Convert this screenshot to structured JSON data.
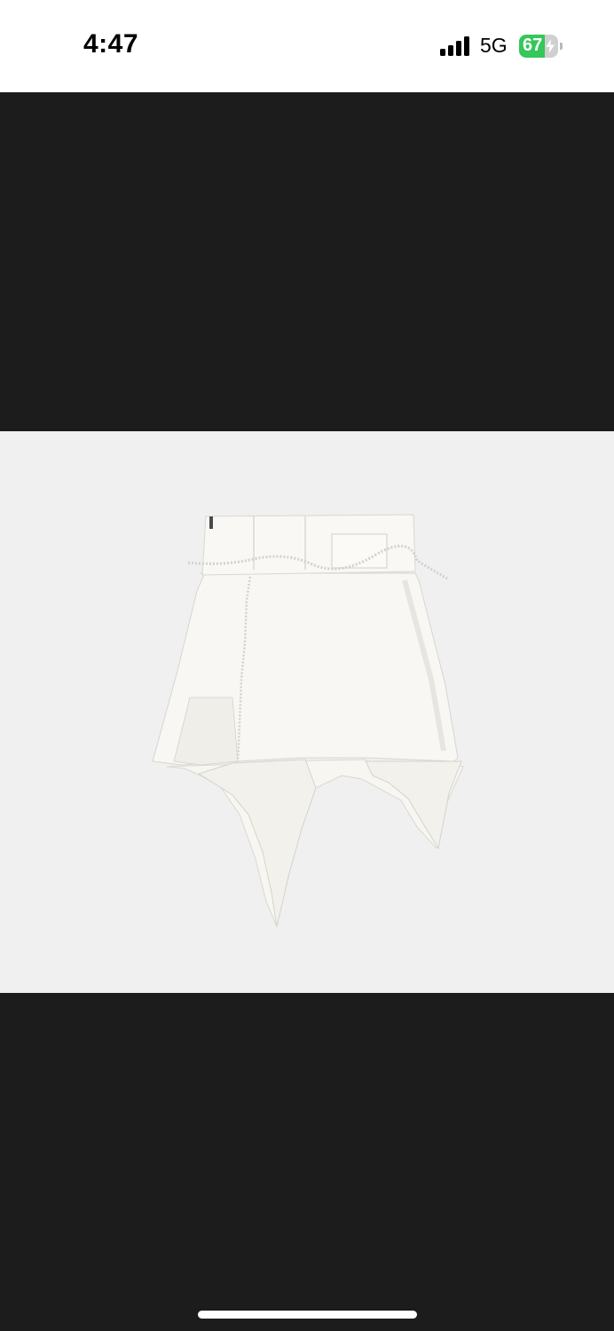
{
  "status_bar": {
    "time": "4:47",
    "network": "5G",
    "battery_percent": "67",
    "battery_level": 0.67,
    "battery_color": "#34c759",
    "charging": true,
    "signal_bars": 4
  },
  "viewer": {
    "background_color": "#1c1c1c",
    "image_background_color": "#f0f0f0"
  },
  "icons": {
    "signal": "cellular-signal-icon",
    "battery": "battery-icon",
    "bolt": "charging-bolt-icon"
  }
}
